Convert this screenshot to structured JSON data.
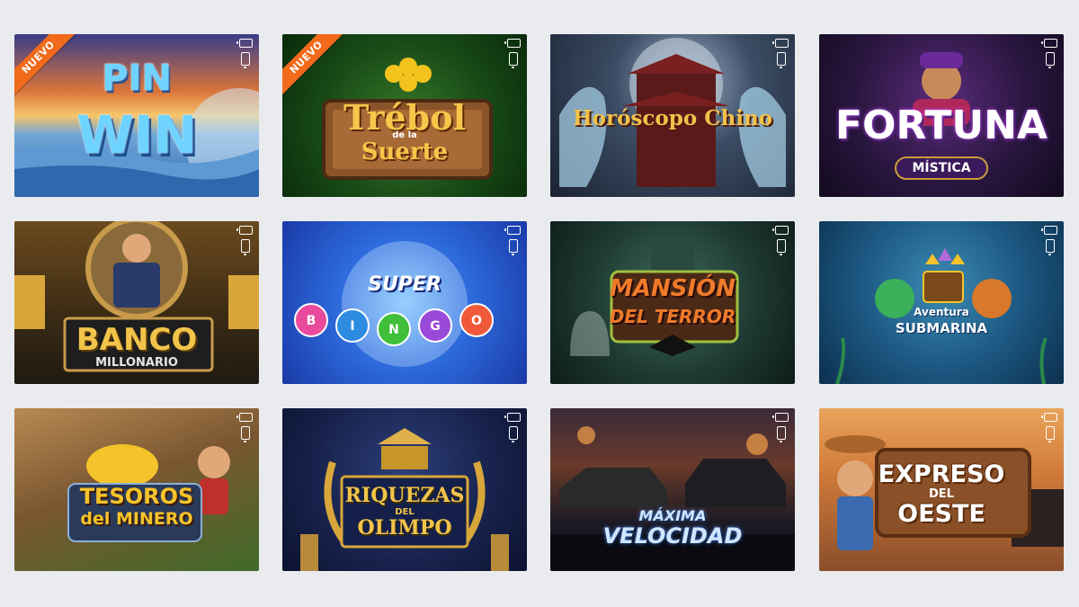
{
  "ribbon_label": "NUEVO",
  "games": [
    {
      "title": "PIN WIN",
      "line1": "PIN",
      "line2": "WIN",
      "badge": "NUEVO"
    },
    {
      "title": "Trébol de la Suerte",
      "line1": "Trébol",
      "small": "de la",
      "line2": "Suerte",
      "badge": "NUEVO"
    },
    {
      "title": "Horóscopo Chino"
    },
    {
      "title": "FORTUNA",
      "subtitle": "MÍSTICA"
    },
    {
      "title": "BANCO",
      "subtitle": "MILLONARIO"
    },
    {
      "title_small": "SUPER",
      "letters": [
        "B",
        "I",
        "N",
        "G",
        "O"
      ]
    },
    {
      "line1": "MANSIÓN",
      "line2": "DEL TERROR"
    },
    {
      "line1": "Aventura",
      "line2": "SUBMARINA"
    },
    {
      "line1": "TESOROS",
      "line2": "del MINERO"
    },
    {
      "line1": "RIQUEZAS",
      "small": "DEL",
      "line2": "OLIMPO"
    },
    {
      "line1": "MÁXIMA",
      "line2": "VELOCIDAD"
    },
    {
      "line1": "EXPRESO",
      "small": "DEL",
      "line2": "OESTE"
    }
  ],
  "colors": {
    "page_bg": "#e9ebef",
    "ribbon": "#f26a1b",
    "bingo_balls": [
      "#e94a9c",
      "#2d8be0",
      "#3fbf3a",
      "#9a4ad8",
      "#f05a3a"
    ]
  },
  "icons": {
    "desktop_tablet": "tablet-icon",
    "mobile": "mobile-icon"
  }
}
